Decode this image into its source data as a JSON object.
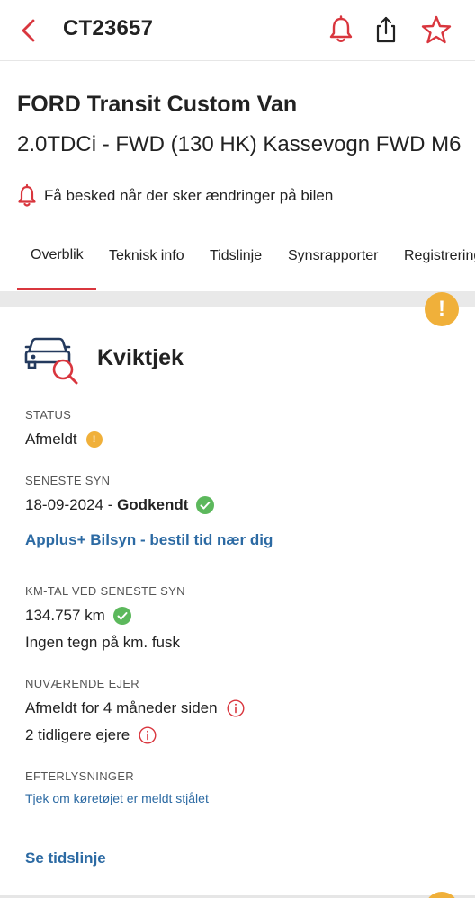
{
  "header": {
    "plate": "CT23657",
    "icons": [
      "chevron-left-icon",
      "bell-icon",
      "share-icon",
      "star-icon"
    ],
    "accent": "#d9363e"
  },
  "vehicle": {
    "make_model": "FORD Transit Custom Van",
    "variant": "2.0TDCi - FWD (130 HK) Kassevogn FWD M6",
    "notify_text": "Få besked når der sker ændringer på bilen"
  },
  "tabs": [
    {
      "label": "Overblik",
      "active": true
    },
    {
      "label": "Teknisk info",
      "active": false
    },
    {
      "label": "Tidslinje",
      "active": false
    },
    {
      "label": "Synsrapporter",
      "active": false
    },
    {
      "label": "Registrering",
      "active": false
    }
  ],
  "overview": {
    "warning_badge": "!",
    "title": "Kviktjek",
    "status": {
      "label": "STATUS",
      "value": "Afmeldt",
      "badge": "!"
    },
    "last_inspection": {
      "label": "SENESTE SYN",
      "date": "18-09-2024",
      "separator": " - ",
      "result": "Godkendt",
      "link": "Applus+ Bilsyn - bestil tid nær dig"
    },
    "mileage": {
      "label": "KM-TAL VED SENESTE SYN",
      "value": "134.757 km",
      "note": "Ingen tegn på km. fusk"
    },
    "owner": {
      "label": "NUVÆRENDE EJER",
      "current": "Afmeldt for 4 måneder siden",
      "previous": "2 tidligere ejere"
    },
    "wanted": {
      "label": "EFTERLYSNINGER",
      "link": "Tjek om køretøjet er meldt stjålet"
    },
    "timeline_link": "Se tidslinje"
  },
  "colors": {
    "brand_red": "#d9363e",
    "warning": "#f0b03a",
    "success": "#5cb85c",
    "link": "#2c6aa3"
  }
}
